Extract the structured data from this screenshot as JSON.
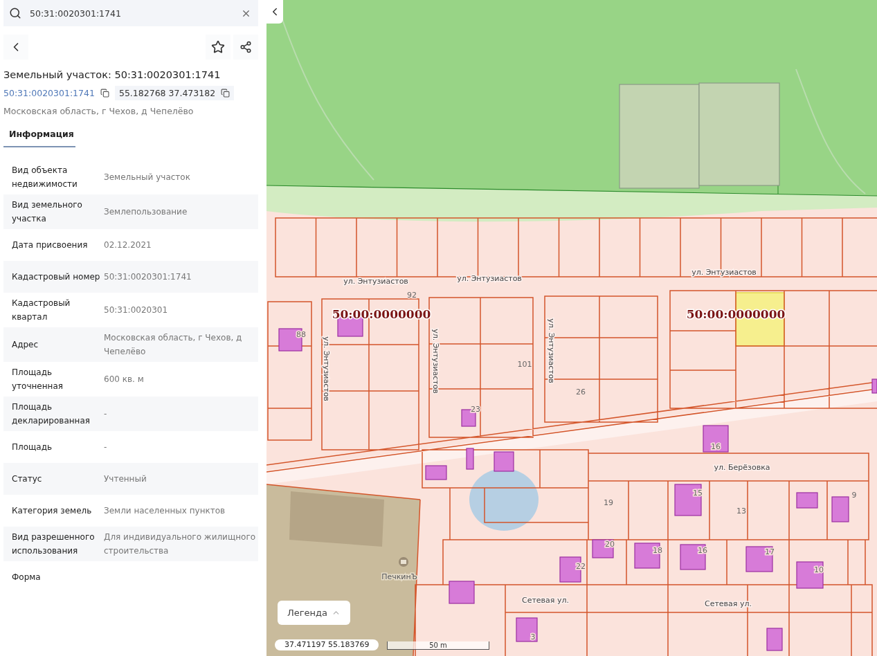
{
  "search": {
    "value": "50:31:0020301:1741"
  },
  "card": {
    "title": "Земельный участок: 50:31:0020301:1741",
    "cadastral_link": "50:31:0020301:1741",
    "coordinates": "55.182768 37.473182",
    "address": "Московская область, г Чехов, д Чепелёво"
  },
  "tabs": [
    {
      "label": "Информация",
      "selected": true
    }
  ],
  "properties": [
    {
      "label": "Вид объекта недвижимости",
      "value": "Земельный участок"
    },
    {
      "label": "Вид земельного участка",
      "value": "Землепользование"
    },
    {
      "label": "Дата присвоения",
      "value": "02.12.2021"
    },
    {
      "label": "Кадастровый номер",
      "value": "50:31:0020301:1741"
    },
    {
      "label": "Кадастровый квартал",
      "value": "50:31:0020301"
    },
    {
      "label": "Адрес",
      "value": "Московская область, г Чехов, д Чепелёво"
    },
    {
      "label": "Площадь уточненная",
      "value": "600 кв. м"
    },
    {
      "label": "Площадь декларированная",
      "value": "-"
    },
    {
      "label": "Площадь",
      "value": "-"
    },
    {
      "label": "Статус",
      "value": "Учтенный"
    },
    {
      "label": "Категория земель",
      "value": "Земли населенных пунктов"
    },
    {
      "label": "Вид разрешенного использования",
      "value": "Для индивидуального жилищного строительства"
    },
    {
      "label": "Форма"
    }
  ],
  "map": {
    "labels": [
      {
        "kind": "street",
        "text": "ул. Энтузиастов"
      },
      {
        "kind": "street",
        "text": "ул. Энтузиастов"
      },
      {
        "kind": "street",
        "text": "ул. Энтузиастов"
      },
      {
        "kind": "street-vertical",
        "text": "ул. Энтузиастов"
      },
      {
        "kind": "street-vertical",
        "text": "ул. Энтузиастов"
      },
      {
        "kind": "street-vertical",
        "text": "ул. Энтузиастов"
      },
      {
        "kind": "number",
        "text": "92"
      },
      {
        "kind": "cadastral",
        "text": "50:00:0000000"
      },
      {
        "kind": "number",
        "text": "88"
      },
      {
        "kind": "number",
        "text": "101"
      },
      {
        "kind": "cadastral",
        "text": "50:00:0000000"
      },
      {
        "kind": "number",
        "text": "23"
      },
      {
        "kind": "number",
        "text": "26"
      },
      {
        "kind": "number",
        "text": "16"
      },
      {
        "kind": "street",
        "text": "ул. Берёзовка"
      },
      {
        "kind": "number",
        "text": "19"
      },
      {
        "kind": "number",
        "text": "15"
      },
      {
        "kind": "number",
        "text": "13"
      },
      {
        "kind": "number",
        "text": "9"
      },
      {
        "kind": "number",
        "text": "20"
      },
      {
        "kind": "number",
        "text": "18"
      },
      {
        "kind": "number",
        "text": "16"
      },
      {
        "kind": "number",
        "text": "17"
      },
      {
        "kind": "number",
        "text": "10"
      },
      {
        "kind": "number",
        "text": "22"
      },
      {
        "kind": "poi",
        "text": "ПечкинЪ"
      },
      {
        "kind": "street",
        "text": "Сетевая ул."
      },
      {
        "kind": "street",
        "text": "Сетевая ул."
      },
      {
        "kind": "number",
        "text": "3"
      }
    ],
    "legend_button": "Легенда",
    "cursor_coordinates": "37.471197 55.183769",
    "scale": "50 m"
  }
}
